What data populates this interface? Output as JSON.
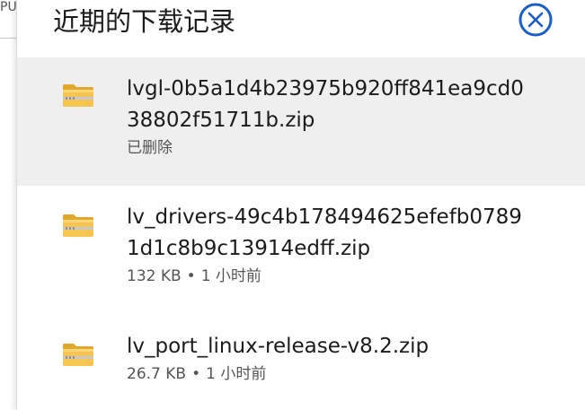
{
  "background": {
    "fragment": "PU"
  },
  "panel": {
    "title": "近期的下载记录",
    "close_icon": "close-circle-icon"
  },
  "downloads": [
    {
      "name": "lvgl-0b5a1d4b23975b920ff841ea9cd038802f51711b.zip",
      "name_line1": "lvgl-0b5a1d4b23975b920ff841ea9cd0",
      "name_line2": "38802f51711b.zip",
      "status": "已删除",
      "icon": "zip-folder-icon",
      "selected": true
    },
    {
      "name": "lv_drivers-49c4b178494625efefb07891d1c8b9c13914edff.zip",
      "name_line1": "lv_drivers-49c4b178494625efefb0789",
      "name_line2": "1d1c8b9c13914edff.zip",
      "size": "132 KB",
      "separator": "•",
      "time": "1 小时前",
      "icon": "zip-folder-icon",
      "selected": false
    },
    {
      "name": "lv_port_linux-release-v8.2.zip",
      "size": "26.7 KB",
      "separator": "•",
      "time": "1 小时前",
      "icon": "zip-folder-icon",
      "selected": false
    }
  ],
  "colors": {
    "accent": "#1a5fc7",
    "selected_row": "#efefef",
    "folder": "#f5c451"
  }
}
